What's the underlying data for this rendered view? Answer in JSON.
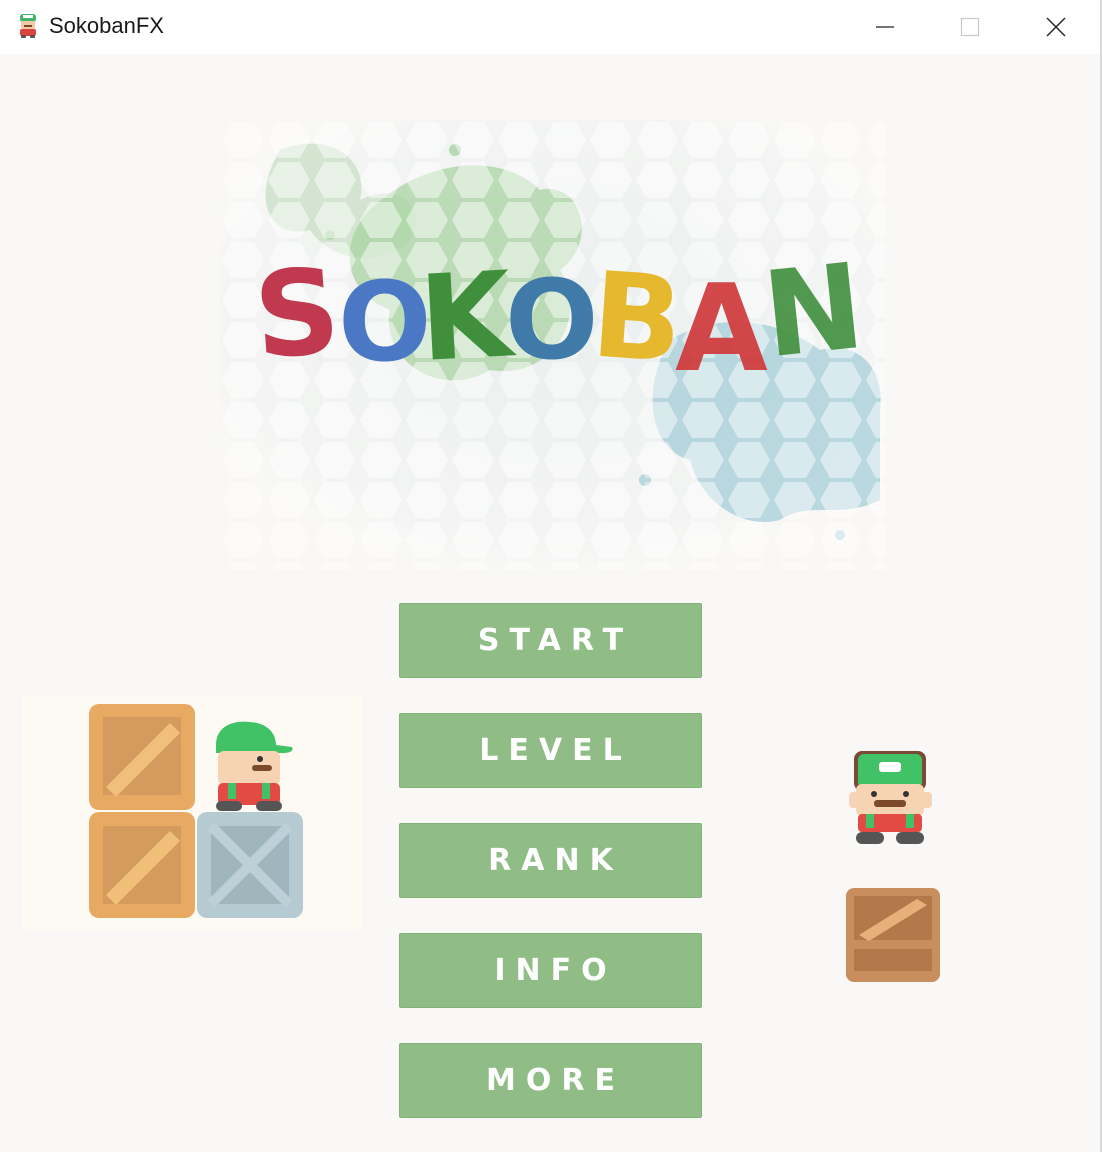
{
  "window": {
    "title": "SokobanFX",
    "controls": {
      "minimize": "minimize-icon",
      "maximize": "maximize-icon",
      "close": "close-icon"
    }
  },
  "logo": {
    "text": "SOKOBAN",
    "letter_colors": [
      "#c0394f",
      "#4a78c4",
      "#3f8f3c",
      "#3f7aa8",
      "#e6b82e",
      "#d0393c",
      "#3f8f3c"
    ]
  },
  "menu": {
    "start": "START",
    "level": "LEVEL",
    "rank": "RANK",
    "info": "INFO",
    "more": "MORE"
  },
  "colors": {
    "button": "#8fbd85",
    "button_text": "#ffffff",
    "background": "#f9f8f6"
  }
}
